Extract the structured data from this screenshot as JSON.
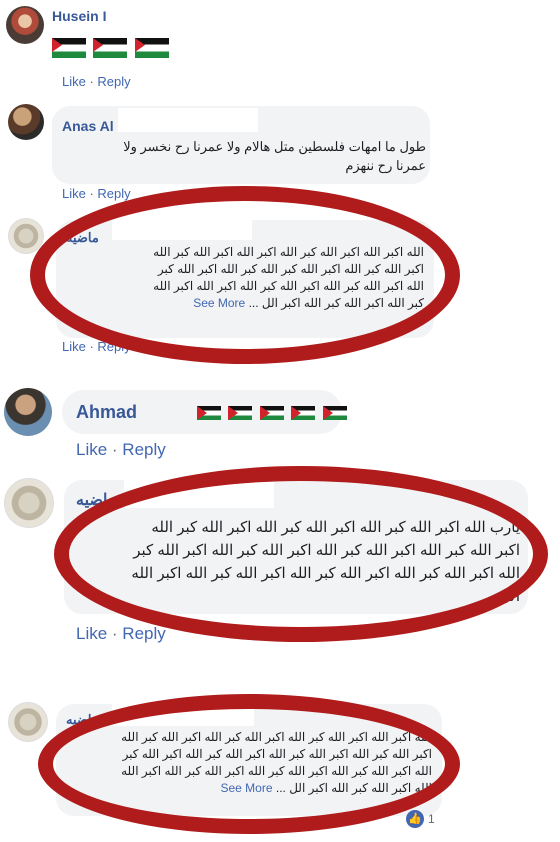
{
  "actions": {
    "like": "Like",
    "reply": "Reply",
    "sep": " · "
  },
  "see_more": "See More",
  "comments": [
    {
      "author": "Husein I"
    },
    {
      "author": "Anas Al",
      "lines": [
        "طول ما امهات فلسطين متل هالام ولا عمرنا رح نخسر ولا",
        "عمرنا رح ننهزم"
      ]
    },
    {
      "author": "ماضيه",
      "lines": [
        "الله اكبر الله اكبر الله كبر الله اكبر الله اكبر الله كبر الله",
        "اكبر الله كبر الله اكبر الله كبر الله كبر الله اكبر الله كبر",
        "الله اكبر الله كبر الله اكبر الله كبر الله اكبر الله اكبر الله",
        "كبر الله اكبر الله كبر الله اكبر الل ..."
      ]
    },
    {
      "author": "Ahmad"
    },
    {
      "author": "ماضيه",
      "lines": [
        "يارب الله اكبر الله كبر الله اكبر الله كبر الله اكبر الله كبر الله",
        "اكبر الله كبر الله اكبر الله كبر الله اكبر الله كبر الله اكبر الله كبر",
        "الله اكبر الله كبر الله اكبر الله كبر الله اكبر الله كبر الله اكبر الله",
        "اكبر"
      ]
    },
    {
      "author": "ماضيه",
      "lines": [
        "الله اكبر الله اكبر الله كبر الله اكبر الله كبر الله اكبر الله كبر الله",
        "اكبر الله كبر الله اكبر الله كبر الله اكبر الله كبر الله اكبر الله كبر",
        "الله اكبر الله كبر الله اكبر الله كبر الله اكبر الله كبر الله اكبر الله",
        "الله اكبر الله كبر الله اكبر الل ..."
      ],
      "reaction_count": "1"
    }
  ],
  "colors": {
    "accent_link": "#4267b2",
    "name": "#385898",
    "annotation_red": "#b01c1c"
  },
  "icons": {
    "reaction": "thumbs-up-icon",
    "flag": "palestine-flag-icon"
  }
}
